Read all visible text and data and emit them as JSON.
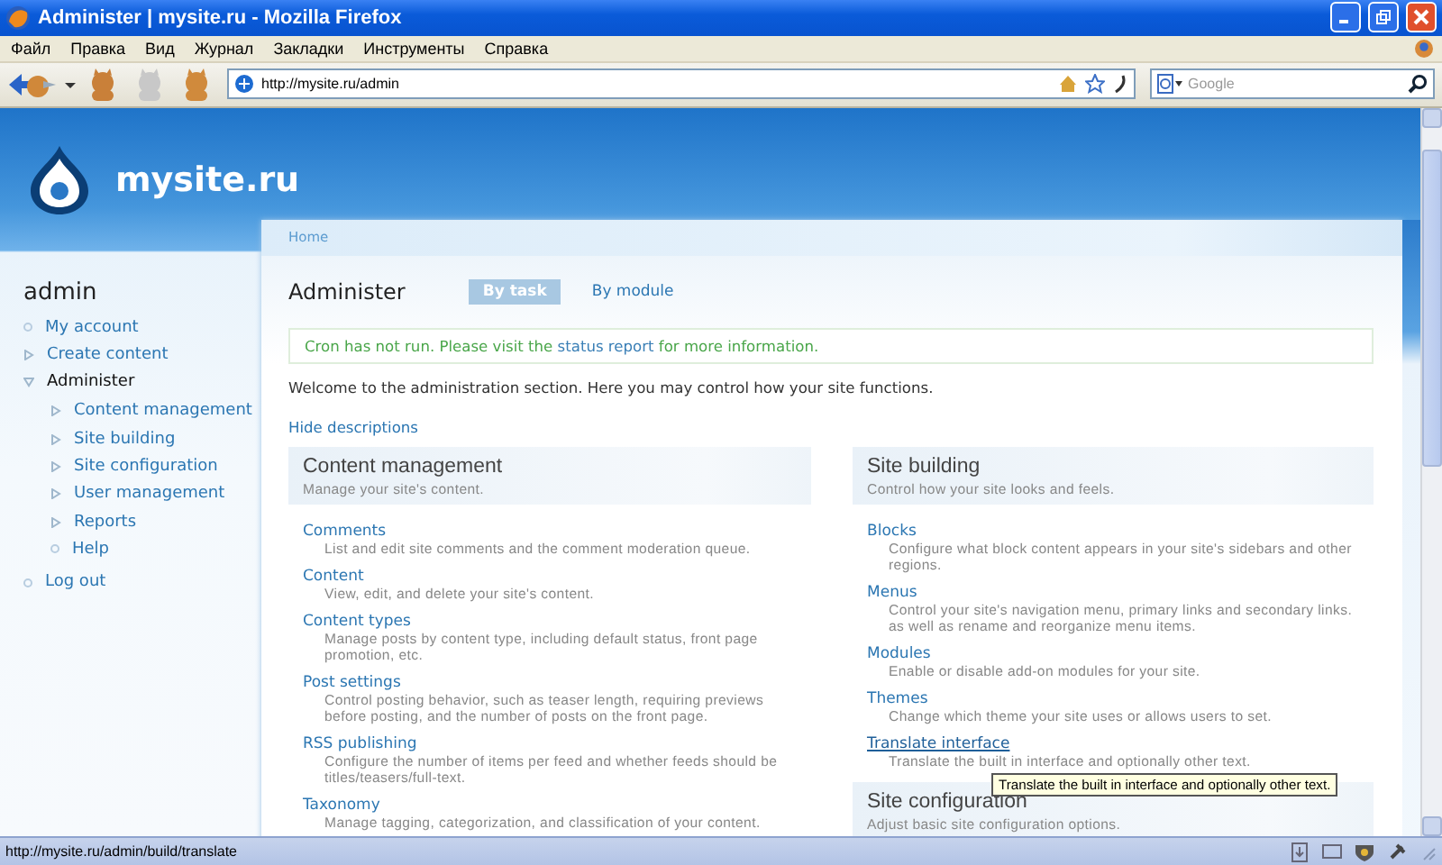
{
  "window": {
    "title": "Administer | mysite.ru - Mozilla Firefox"
  },
  "menu_bar": [
    "Файл",
    "Правка",
    "Вид",
    "Журнал",
    "Закладки",
    "Инструменты",
    "Справка"
  ],
  "address_bar": {
    "url": "http://mysite.ru/admin"
  },
  "search": {
    "placeholder": "Google"
  },
  "site": {
    "name": "mysite.ru"
  },
  "sidebar": {
    "title": "admin",
    "items": [
      {
        "label": "My account",
        "kind": "leaf",
        "active": false
      },
      {
        "label": "Create content",
        "kind": "branch",
        "expanded": false,
        "active": false
      },
      {
        "label": "Administer",
        "kind": "branch",
        "expanded": true,
        "active": true,
        "children": [
          {
            "label": "Content management",
            "kind": "branch",
            "expanded": false,
            "active": false
          },
          {
            "label": "Site building",
            "kind": "branch",
            "expanded": false,
            "active": false
          },
          {
            "label": "Site configuration",
            "kind": "branch",
            "expanded": false,
            "active": false
          },
          {
            "label": "User management",
            "kind": "branch",
            "expanded": false,
            "active": false
          },
          {
            "label": "Reports",
            "kind": "branch",
            "expanded": false,
            "active": false
          },
          {
            "label": "Help",
            "kind": "leaf",
            "active": false
          }
        ]
      },
      {
        "label": "Log out",
        "kind": "leaf",
        "active": false
      }
    ]
  },
  "breadcrumb": [
    "Home"
  ],
  "page": {
    "title": "Administer"
  },
  "tabs": [
    {
      "label": "By task",
      "selected": true
    },
    {
      "label": "By module",
      "selected": false
    }
  ],
  "message": {
    "before": "Cron has not run. Please visit the ",
    "link": "status report",
    "after": " for more information."
  },
  "welcome": "Welcome to the administration section. Here you may control how your site functions.",
  "hide_descriptions": "Hide descriptions",
  "columns": [
    {
      "sections": [
        {
          "title": "Content management",
          "description": "Manage your site's content.",
          "items": [
            {
              "label": "Comments",
              "description": "List and edit site comments and the comment moderation queue.",
              "hovered": false
            },
            {
              "label": "Content",
              "description": "View, edit, and delete your site's content.",
              "hovered": false
            },
            {
              "label": "Content types",
              "description": "Manage posts by content type, including default status, front page promotion, etc.",
              "hovered": false
            },
            {
              "label": "Post settings",
              "description": "Control posting behavior, such as teaser length, requiring previews before posting, and the number of posts on the front page.",
              "hovered": false
            },
            {
              "label": "RSS publishing",
              "description": "Configure the number of items per feed and whether feeds should be titles/teasers/full-text.",
              "hovered": false
            },
            {
              "label": "Taxonomy",
              "description": "Manage tagging, categorization, and classification of your content.",
              "hovered": false
            }
          ]
        }
      ]
    },
    {
      "sections": [
        {
          "title": "Site building",
          "description": "Control how your site looks and feels.",
          "items": [
            {
              "label": "Blocks",
              "description": "Configure what block content appears in your site's sidebars and other regions.",
              "hovered": false
            },
            {
              "label": "Menus",
              "description": "Control your site's navigation menu, primary links and secondary links. as well as rename and reorganize menu items.",
              "hovered": false
            },
            {
              "label": "Modules",
              "description": "Enable or disable add-on modules for your site.",
              "hovered": false
            },
            {
              "label": "Themes",
              "description": "Change which theme your site uses or allows users to set.",
              "hovered": false
            },
            {
              "label": "Translate interface",
              "description": "Translate the built in interface and optionally other text.",
              "hovered": true
            }
          ]
        },
        {
          "title": "Site configuration",
          "description": "Adjust basic site configuration options."
        }
      ]
    }
  ],
  "tooltip": "Translate the built in interface and optionally other text.",
  "status_bar": {
    "text": "http://mysite.ru/admin/build/translate"
  }
}
